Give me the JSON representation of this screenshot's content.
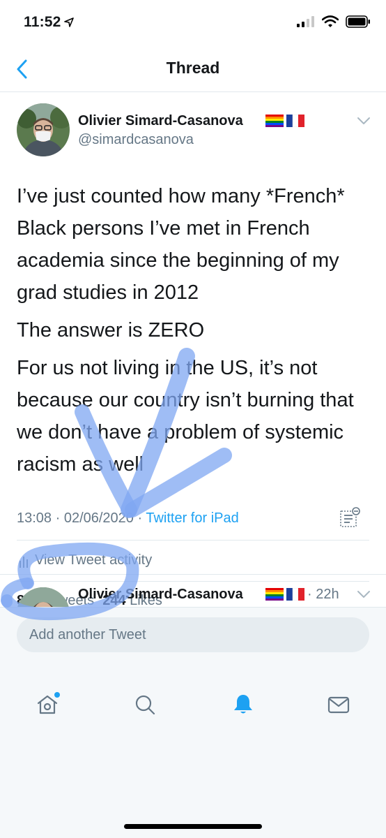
{
  "status_bar": {
    "time": "11:52",
    "location_icon": "location-arrow-icon",
    "signal_icon": "signal-icon",
    "wifi_icon": "wifi-icon",
    "battery_icon": "battery-icon"
  },
  "nav": {
    "title": "Thread",
    "back_icon": "chevron-left-icon"
  },
  "tweet": {
    "author_name": "Olivier Simard-Casanova",
    "author_handle": "@simardcasanova",
    "body": [
      "I’ve just counted how many *French* Black persons I’ve met in French academia since the beginning of my grad studies in 2012",
      "The answer is ZERO",
      "For us not living in the US, it’s not because our country isn’t burning that we don’t have a problem of systemic racism as well"
    ],
    "timestamp": "13:08 · 02/06/2020 · ",
    "source": "Twitter for iPad",
    "activity_label": "View Tweet activity",
    "retweets_count": "87",
    "retweets_label": "Retweets",
    "likes_count": "244",
    "likes_label": "Likes"
  },
  "reply_preview": {
    "author_name": "Olivier Simard-Casanova",
    "time": "· 22h"
  },
  "compose": {
    "placeholder": "Add another Tweet"
  },
  "tabs": [
    "home-icon",
    "search-icon",
    "notifications-icon",
    "messages-icon"
  ],
  "colors": {
    "accent": "#1da1f2",
    "secondary_text": "#657786",
    "annotation": "#7fa7f2"
  }
}
